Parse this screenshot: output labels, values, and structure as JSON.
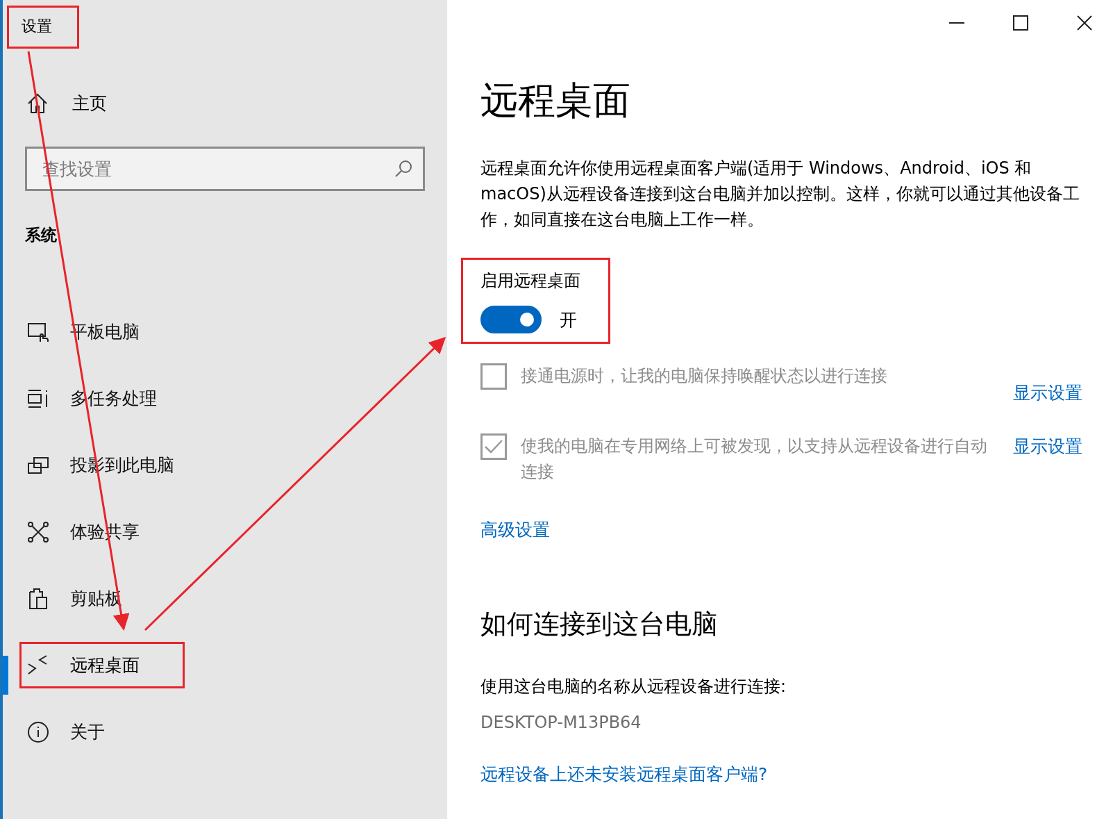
{
  "window": {
    "title": "设置",
    "title_highlighted": true
  },
  "sidebar": {
    "home": "主页",
    "search": {
      "placeholder": "查找设置"
    },
    "section": "系统",
    "items": [
      {
        "label": "平板电脑",
        "kind": "tablet",
        "selected": false,
        "highlighted": false
      },
      {
        "label": "多任务处理",
        "kind": "multitask",
        "selected": false,
        "highlighted": false
      },
      {
        "label": "投影到此电脑",
        "kind": "project",
        "selected": false,
        "highlighted": false
      },
      {
        "label": "体验共享",
        "kind": "share",
        "selected": false,
        "highlighted": false
      },
      {
        "label": "剪贴板",
        "kind": "clipboard",
        "selected": false,
        "highlighted": false
      },
      {
        "label": "远程桌面",
        "kind": "remote",
        "selected": true,
        "highlighted": true
      },
      {
        "label": "关于",
        "kind": "about",
        "selected": false,
        "highlighted": false
      }
    ]
  },
  "page": {
    "title": "远程桌面",
    "description": "远程桌面允许你使用远程桌面客户端(适用于 Windows、Android、iOS 和 macOS)从远程设备连接到这台电脑并加以控制。这样，你就可以通过其他设备工作，如同直接在这台电脑上工作一样。",
    "toggle": {
      "label": "启用远程桌面",
      "on": true,
      "state_text": "开",
      "highlighted": true
    },
    "options": [
      {
        "text": "接通电源时，让我的电脑保持唤醒状态以进行连接",
        "checked": false,
        "disabled": true,
        "link": "显示设置"
      },
      {
        "text": "使我的电脑在专用网络上可被发现，以支持从远程设备进行自动连接",
        "checked": true,
        "disabled": true,
        "link": "显示设置"
      }
    ],
    "advanced_link": "高级设置",
    "section_title": "如何连接到这台电脑",
    "connect_text": "使用这台电脑的名称从远程设备进行连接:",
    "pc_name": "DESKTOP-M13PB64",
    "help_link": "远程设备上还未安装远程桌面客户端?"
  }
}
